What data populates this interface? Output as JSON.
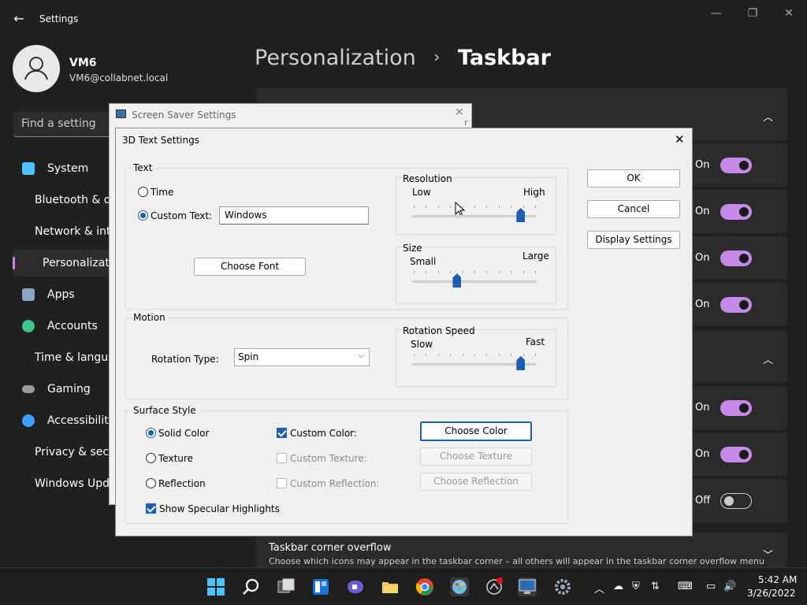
{
  "settings": {
    "title": "Settings",
    "user": {
      "name": "VM6",
      "email": "VM6@collabnet.local"
    },
    "search_placeholder": "Find a setting",
    "nav": [
      {
        "label": "System",
        "color": "#4cc2ff"
      },
      {
        "label": "Bluetooth & devices",
        "color": "#2e8be6"
      },
      {
        "label": "Network & internet",
        "color": "#5cc8ff"
      },
      {
        "label": "Personalization",
        "color": "#e3a36b"
      },
      {
        "label": "Apps",
        "color": "#8aa4c8"
      },
      {
        "label": "Accounts",
        "color": "#3cc58a"
      },
      {
        "label": "Time & language",
        "color": "#4aa0e6"
      },
      {
        "label": "Gaming",
        "color": "#9a9a9a"
      },
      {
        "label": "Accessibility",
        "color": "#3aa0ff"
      },
      {
        "label": "Privacy & security",
        "color": "#8a8a8a"
      },
      {
        "label": "Windows Update",
        "color": "#2e8be6"
      }
    ],
    "breadcrumb": {
      "parent": "Personalization",
      "sep": "›",
      "current": "Taskbar"
    },
    "toggles": [
      {
        "label": "On",
        "state": true
      },
      {
        "label": "On",
        "state": true
      },
      {
        "label": "On",
        "state": true
      },
      {
        "label": "On",
        "state": true
      },
      {
        "label": "On",
        "state": true
      },
      {
        "label": "On",
        "state": true
      },
      {
        "label": "Off",
        "state": false
      }
    ],
    "corner_overflow": {
      "title": "Taskbar corner overflow",
      "desc": "Choose which icons may appear in the taskbar corner – all others will appear in the taskbar corner overflow menu"
    }
  },
  "screensaver": {
    "title": "Screen Saver Settings",
    "fragment": "r"
  },
  "dialog": {
    "title": "3D Text Settings",
    "text_group": {
      "label": "Text",
      "time_label": "Time",
      "custom_label": "Custom Text:",
      "custom_value": "Windows",
      "choose_font": "Choose Font"
    },
    "resolution": {
      "label": "Resolution",
      "low": "Low",
      "high": "High",
      "value": 0.9
    },
    "size": {
      "label": "Size",
      "small": "Small",
      "large": "Large",
      "value": 0.35
    },
    "motion": {
      "label": "Motion",
      "rotation_type_label": "Rotation Type:",
      "rotation_type": "Spin"
    },
    "rotation_speed": {
      "label": "Rotation Speed",
      "slow": "Slow",
      "fast": "Fast",
      "value": 0.9
    },
    "surface": {
      "label": "Surface Style",
      "solid": "Solid Color",
      "texture": "Texture",
      "reflection": "Reflection",
      "custom_color": "Custom Color:",
      "custom_texture": "Custom Texture:",
      "custom_reflection": "Custom Reflection:",
      "choose_color": "Choose Color",
      "choose_texture": "Choose Texture",
      "choose_reflection": "Choose Reflection",
      "specular": "Show Specular Highlights"
    },
    "ok": "OK",
    "cancel": "Cancel",
    "display_settings": "Display Settings"
  },
  "taskbar": {
    "time": "5:42 AM",
    "date": "3/26/2022"
  }
}
